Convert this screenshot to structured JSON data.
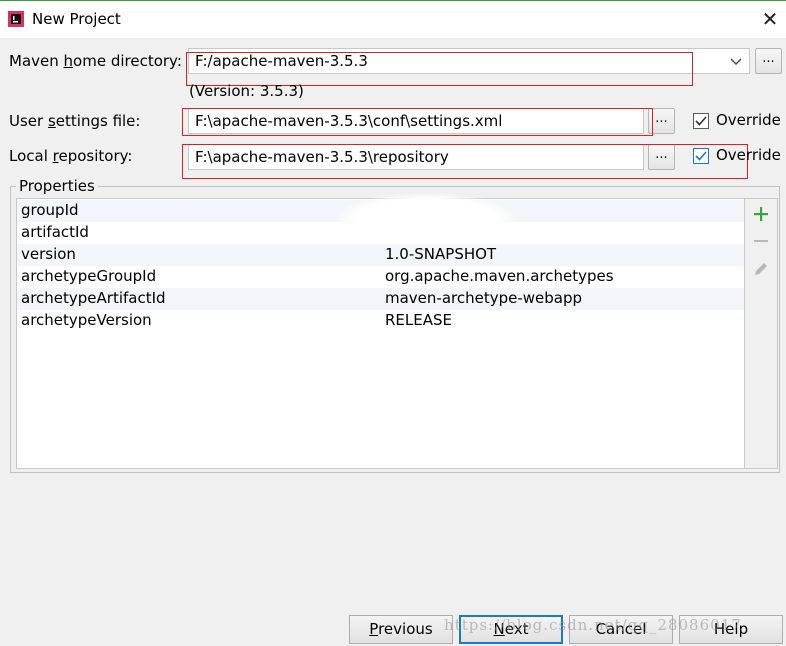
{
  "window": {
    "title": "New Project",
    "app_icon": "intellij-idea-icon",
    "close_glyph": "✕"
  },
  "form": {
    "maven_home": {
      "label_pre": "Maven ",
      "label_mnemonic": "h",
      "label_post": "ome directory:",
      "value": "F:/apache-maven-3.5.3",
      "version_note": "(Version: 3.5.3)"
    },
    "user_settings": {
      "label_pre": "User ",
      "label_mnemonic": "s",
      "label_post": "ettings file:",
      "value": "F:\\apache-maven-3.5.3\\conf\\settings.xml",
      "override_label": "Override",
      "override_checked": true
    },
    "local_repo": {
      "label_pre": "Local ",
      "label_mnemonic": "r",
      "label_post": "epository:",
      "value": "F:\\apache-maven-3.5.3\\repository",
      "override_label": "Override",
      "override_checked": true
    },
    "browse_label": "..."
  },
  "properties": {
    "title": "Properties",
    "rows": [
      {
        "key": "groupId",
        "value": ""
      },
      {
        "key": "artifactId",
        "value": "."
      },
      {
        "key": "version",
        "value": "1.0-SNAPSHOT"
      },
      {
        "key": "archetypeGroupId",
        "value": "org.apache.maven.archetypes"
      },
      {
        "key": "archetypeArtifactId",
        "value": "maven-archetype-webapp"
      },
      {
        "key": "archetypeVersion",
        "value": "RELEASE"
      }
    ]
  },
  "buttons": {
    "previous": {
      "mnemonic": "P",
      "rest": "revious"
    },
    "next": {
      "mnemonic": "N",
      "rest": "ext"
    },
    "cancel": "Cancel",
    "help": "Help"
  },
  "watermark": "https://blog.csdn.net/qq_28086017",
  "colors": {
    "highlight": "#e02020",
    "focus": "#1979ca",
    "add": "#3aa53a"
  }
}
